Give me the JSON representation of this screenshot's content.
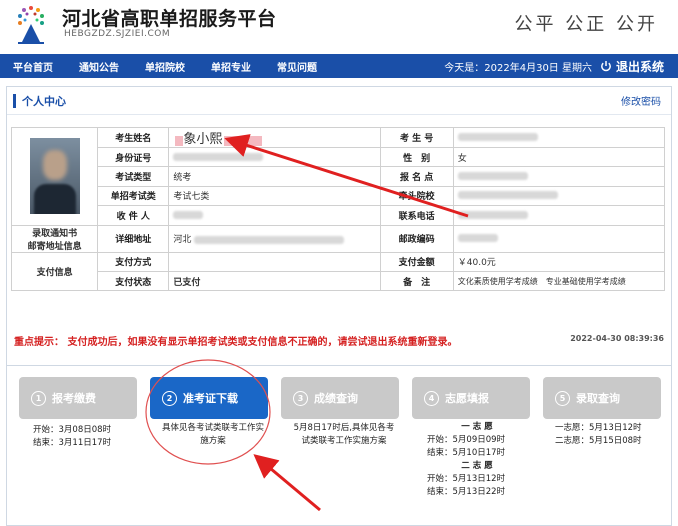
{
  "header": {
    "site_title": "河北省高职单招服务平台",
    "site_url": "HEBGZDZ.SJZIEI.COM",
    "slogan": "公平  公正  公开"
  },
  "nav": {
    "items": [
      "平台首页",
      "通知公告",
      "单招院校",
      "单招专业",
      "常见问题"
    ],
    "date_text": "今天是：2022年4月30日 星期六",
    "logout_label": "退出系统"
  },
  "panel": {
    "title": "个人中心",
    "change_pwd": "修改密码"
  },
  "info": {
    "left_mail": "录取通知书\n邮寄地址信息",
    "left_pay": "支付信息",
    "name_label": "考生姓名",
    "name_value": "象小熙",
    "exam_no_label": "考 生 号",
    "id_label": "身份证号",
    "gender_label": "性　别",
    "gender_value": "女",
    "exam_type_label": "考试类型",
    "exam_type_value": "统考",
    "exam_site_label": "报 名 点",
    "category_label": "单招考试类",
    "category_value": "考试七类",
    "lead_school_label": "牵头院校",
    "recipient_label": "收 件 人",
    "phone_label": "联系电话",
    "address_label": "详细地址",
    "address_value": "河北",
    "postcode_label": "邮政编码",
    "pay_method_label": "支付方式",
    "pay_amount_label": "支付金额",
    "pay_amount_value": "￥40.0元",
    "pay_status_label": "支付状态",
    "pay_status_value": "已支付",
    "remark_label": "备　注",
    "remark_value": "文化素质使用学考成绩　专业基础使用学考成绩"
  },
  "notice": {
    "text": "重点提示：  支付成功后，如果没有显示单招考试类或支付信息不正确的，请尝试退出系统重新登录。",
    "time": "2022-04-30 08:39:36"
  },
  "steps": [
    {
      "num": "1",
      "label": "报考缴费",
      "lines": [
        "开始：3月08日08时",
        "结束：3月11日17时"
      ]
    },
    {
      "num": "2",
      "label": "准考证下载",
      "lines": [
        "具体见各考试类联考工作实",
        "施方案"
      ]
    },
    {
      "num": "3",
      "label": "成绩查询",
      "lines": [
        "5月8日17时后,具体见各考",
        "试类联考工作实施方案"
      ]
    },
    {
      "num": "4",
      "label": "志愿填报",
      "lines": [
        "一 志 愿",
        "开始：5月09日09时",
        "结束：5月10日17时",
        "二 志 愿",
        "开始：5月13日12时",
        "结束：5月13日22时"
      ]
    },
    {
      "num": "5",
      "label": "录取查询",
      "lines": [
        "一志愿：5月13日12时",
        "二志愿：5月15日08时"
      ]
    }
  ],
  "colors": {
    "nav_bg": "#1a4fa8",
    "active_step": "#1a67c7",
    "inactive_step": "#c9c9c9",
    "annotation_red": "#e02020"
  }
}
